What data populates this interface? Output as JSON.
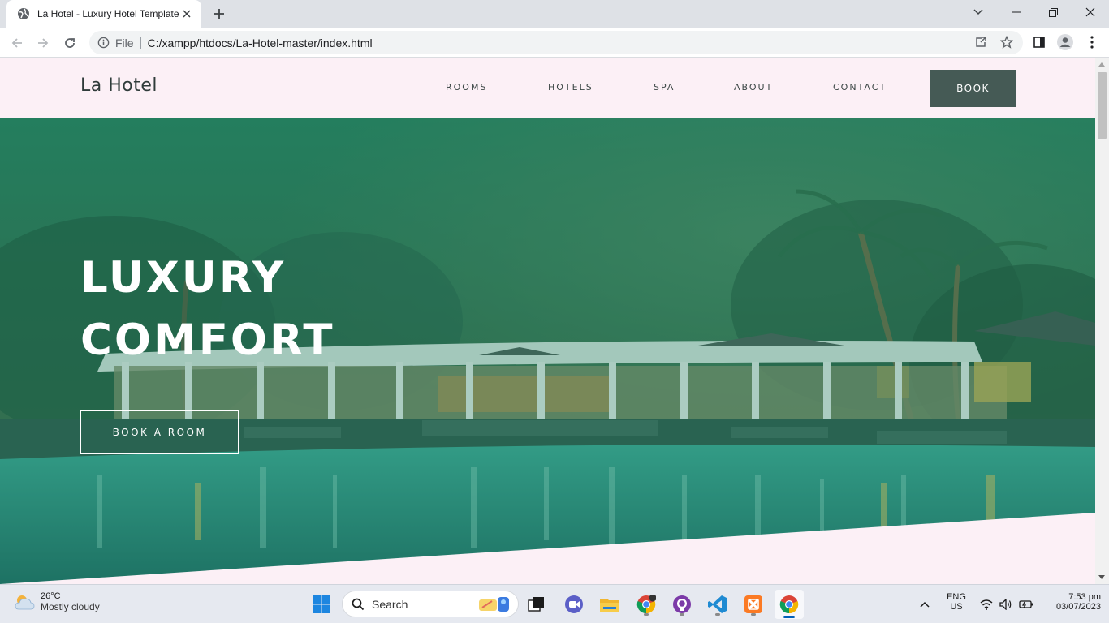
{
  "browser": {
    "tab_title": "La Hotel - Luxury Hotel Template",
    "url_scheme": "File",
    "url": "C:/xampp/htdocs/La-Hotel-master/index.html"
  },
  "site": {
    "brand": "La Hotel",
    "nav": [
      "ROOMS",
      "HOTELS",
      "SPA",
      "ABOUT",
      "CONTACT"
    ],
    "book_label": "BOOK",
    "hero_title": [
      "LUXURY",
      "COMFORT"
    ],
    "hero_cta": "BOOK A ROOM",
    "colors": {
      "header_bg": "#fcf0f6",
      "accent": "#455a55",
      "hero_overlay": "#1f7a5c"
    }
  },
  "taskbar": {
    "weather_temp": "26°C",
    "weather_desc": "Mostly cloudy",
    "search_label": "Search",
    "lang": "ENG",
    "region": "US",
    "time": "7:53 pm",
    "date": "03/07/2023",
    "pinned": [
      "start-icon",
      "search-icon",
      "task-view-icon",
      "teams-icon",
      "file-explorer-icon",
      "chrome-icon",
      "github-desktop-icon",
      "vscode-icon",
      "xampp-icon",
      "chrome-active-icon"
    ]
  }
}
